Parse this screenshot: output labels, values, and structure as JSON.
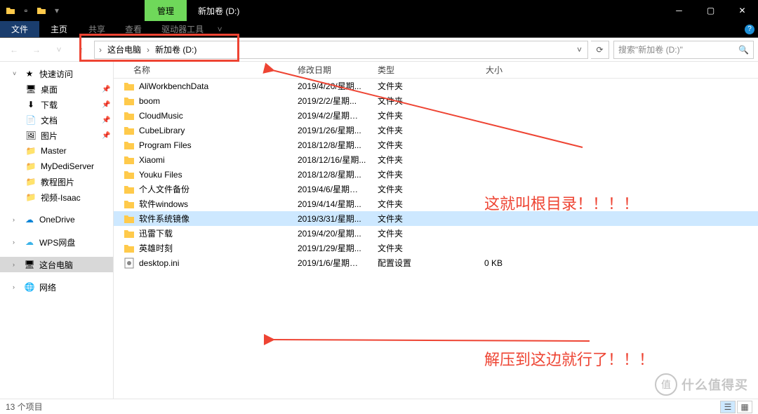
{
  "titlebar": {
    "ribbon_tab_active": "管理",
    "window_title": "新加卷 (D:)"
  },
  "ribbon": {
    "file": "文件",
    "home": "主页",
    "share": "共享",
    "view": "查看",
    "drive_tools": "驱动器工具"
  },
  "breadcrumb": {
    "root": "这台电脑",
    "current": "新加卷 (D:)"
  },
  "search": {
    "placeholder": "搜索\"新加卷 (D:)\""
  },
  "columns": {
    "name": "名称",
    "date": "修改日期",
    "type": "类型",
    "size": "大小"
  },
  "sidebar": {
    "quick": "快速访问",
    "desktop": "桌面",
    "downloads": "下载",
    "documents": "文档",
    "pictures": "图片",
    "master": "Master",
    "mydedi": "MyDediServer",
    "tutorial": "教程图片",
    "video": "视频-Isaac",
    "onedrive": "OneDrive",
    "wps": "WPS网盘",
    "thispc": "这台电脑",
    "network": "网络"
  },
  "rows": [
    {
      "icon": "folder",
      "name": "AliWorkbenchData",
      "date": "2019/4/20/星期...",
      "type": "文件夹",
      "size": ""
    },
    {
      "icon": "folder",
      "name": "boom",
      "date": "2019/2/2/星期...",
      "type": "文件夹",
      "size": ""
    },
    {
      "icon": "folder",
      "name": "CloudMusic",
      "date": "2019/4/2/星期二 ...",
      "type": "文件夹",
      "size": ""
    },
    {
      "icon": "folder",
      "name": "CubeLibrary",
      "date": "2019/1/26/星期...",
      "type": "文件夹",
      "size": ""
    },
    {
      "icon": "folder",
      "name": "Program Files",
      "date": "2018/12/8/星期...",
      "type": "文件夹",
      "size": ""
    },
    {
      "icon": "folder",
      "name": "Xiaomi",
      "date": "2018/12/16/星期...",
      "type": "文件夹",
      "size": ""
    },
    {
      "icon": "folder",
      "name": "Youku Files",
      "date": "2018/12/8/星期...",
      "type": "文件夹",
      "size": ""
    },
    {
      "icon": "folder",
      "name": "个人文件备份",
      "date": "2019/4/6/星期六 ...",
      "type": "文件夹",
      "size": ""
    },
    {
      "icon": "folder",
      "name": "软件windows",
      "date": "2019/4/14/星期...",
      "type": "文件夹",
      "size": ""
    },
    {
      "icon": "folder",
      "name": "软件系统镜像",
      "date": "2019/3/31/星期...",
      "type": "文件夹",
      "size": "",
      "selected": true
    },
    {
      "icon": "folder",
      "name": "迅雷下载",
      "date": "2019/4/20/星期...",
      "type": "文件夹",
      "size": ""
    },
    {
      "icon": "folder",
      "name": "英雄时刻",
      "date": "2019/1/29/星期...",
      "type": "文件夹",
      "size": ""
    },
    {
      "icon": "file",
      "name": "desktop.ini",
      "date": "2019/1/6/星期日 ...",
      "type": "配置设置",
      "size": "0 KB"
    }
  ],
  "status": {
    "count": "13 个项目"
  },
  "annotations": {
    "root_label": "这就叫根目录！！！！",
    "extract_label": "解压到这边就行了！！！"
  },
  "watermark": {
    "char": "值",
    "text": "什么值得买"
  }
}
